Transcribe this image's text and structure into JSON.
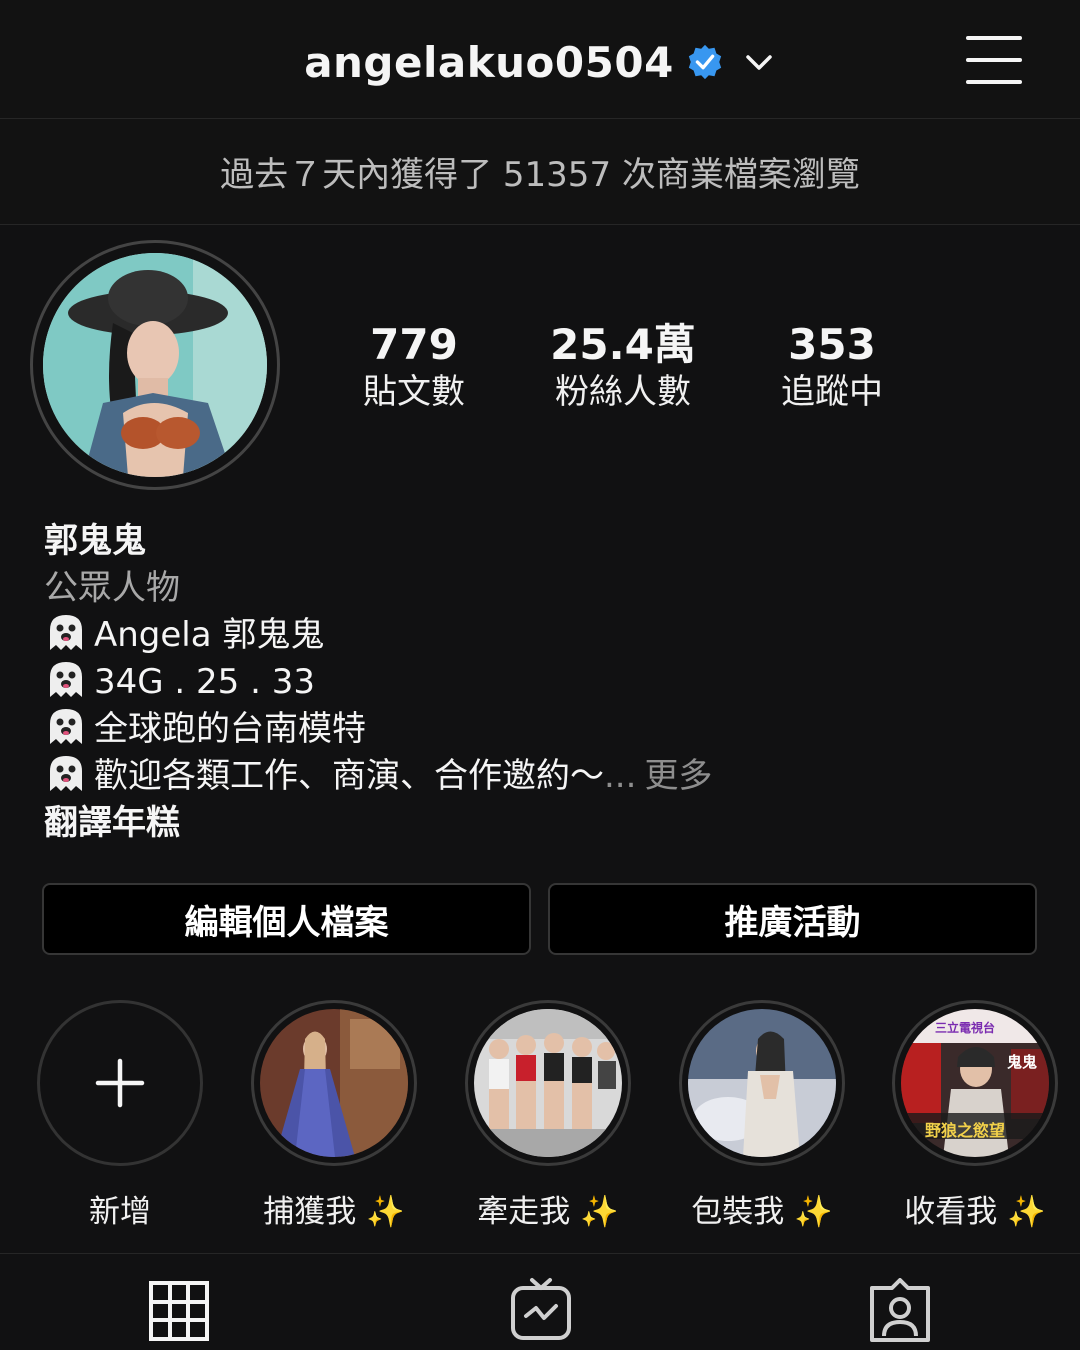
{
  "header": {
    "username": "angelakuo0504",
    "verified_icon": "verified-badge-icon",
    "dropdown_icon": "chevron-down-icon",
    "menu_icon": "hamburger-menu-icon",
    "accent_color": "#3897f0"
  },
  "banner": {
    "text": "過去７天內獲得了 51357 次商業檔案瀏覽"
  },
  "stats": [
    {
      "value": "779",
      "label": "貼文數"
    },
    {
      "value": "25.4萬",
      "label": "粉絲人數"
    },
    {
      "value": "353",
      "label": "追蹤中"
    }
  ],
  "bio": {
    "name": "郭鬼鬼",
    "category": "公眾人物",
    "lines": [
      "Angela 郭鬼鬼",
      "34G . 25 . 33",
      "全球跑的台南模特",
      "歡迎各類工作、商演、合作邀約～"
    ],
    "ellipsis": "...",
    "more": "更多",
    "translate": "翻譯年糕",
    "line_icon": "ghost-emoji-icon"
  },
  "buttons": {
    "edit_profile": "編輯個人檔案",
    "promotions": "推廣活動"
  },
  "highlights": [
    {
      "label": "新增",
      "icon": "plus-icon"
    },
    {
      "label": "捕獲我",
      "sparkle": "✨",
      "overlay": ""
    },
    {
      "label": "牽走我",
      "sparkle": "✨",
      "overlay": ""
    },
    {
      "label": "包裝我",
      "sparkle": "✨",
      "overlay": ""
    },
    {
      "label": "收看我",
      "sparkle": "✨",
      "overlay_top": "三立電視台",
      "overlay_right": "鬼鬼",
      "overlay_bottom": "野狼之慾望"
    }
  ],
  "tabs": [
    {
      "icon": "grid-icon"
    },
    {
      "icon": "igtv-icon"
    },
    {
      "icon": "tagged-user-icon"
    }
  ]
}
